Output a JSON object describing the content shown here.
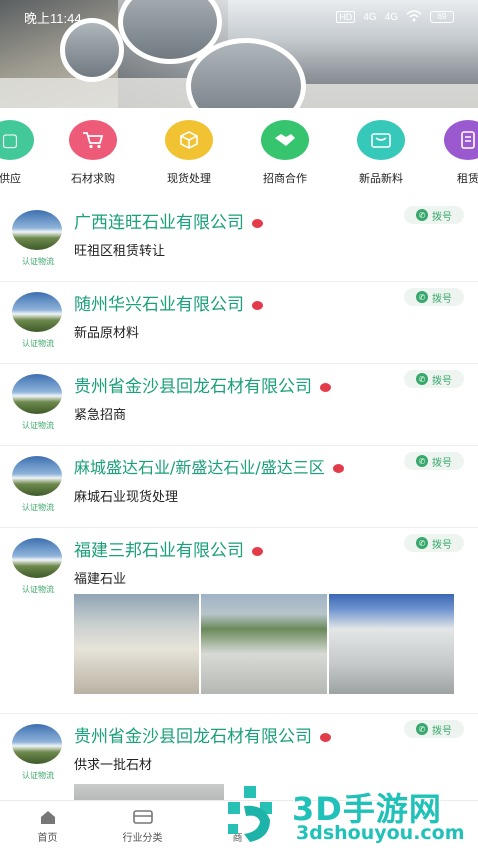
{
  "status": {
    "time": "晚上11:44",
    "hd": "HD",
    "sig1": "4G",
    "sig2": "4G",
    "battery": "69"
  },
  "categories": [
    {
      "label": "供应",
      "color": "#43c89a",
      "icon": "supply-icon"
    },
    {
      "label": "石材求购",
      "color": "#ee5b79",
      "icon": "cart-icon"
    },
    {
      "label": "现货处理",
      "color": "#f1c232",
      "icon": "box-icon"
    },
    {
      "label": "招商合作",
      "color": "#36c46e",
      "icon": "handshake-icon"
    },
    {
      "label": "新品新料",
      "color": "#36c8b8",
      "icon": "new-item-icon"
    },
    {
      "label": "租赁",
      "color": "#9b59d0",
      "icon": "lease-icon"
    }
  ],
  "items": [
    {
      "title": "广西连旺石业有限公司",
      "sub": "旺祖区租赁转让",
      "verified": "认证物流",
      "dial": "拨号"
    },
    {
      "title": "随州华兴石业有限公司",
      "sub": "新品原材料",
      "verified": "认证物流",
      "dial": "拨号"
    },
    {
      "title": "贵州省金沙县回龙石材有限公司",
      "sub": "紧急招商",
      "verified": "认证物流",
      "dial": "拨号"
    },
    {
      "title": "麻城盛达石业/新盛达石业/盛达三区",
      "sub": "麻城石业现货处理",
      "verified": "认证物流",
      "dial": "拨号"
    },
    {
      "title": "福建三邦石业有限公司",
      "sub": "福建石业",
      "verified": "认证物流",
      "dial": "拨号"
    },
    {
      "title": "贵州省金沙县回龙石材有限公司",
      "sub": "供求一批石材",
      "verified": "认证物流",
      "dial": "拨号"
    }
  ],
  "nav": [
    {
      "label": "首页",
      "icon": "home-icon"
    },
    {
      "label": "行业分类",
      "icon": "category-icon"
    },
    {
      "label": "商",
      "icon": "shop-icon"
    }
  ],
  "watermark": {
    "title": "3D手游网",
    "url": "3dshouyou.com"
  },
  "colors": {
    "accent": "#1aa07a",
    "dot": "#e43b4a",
    "dial": "#37a86b"
  }
}
